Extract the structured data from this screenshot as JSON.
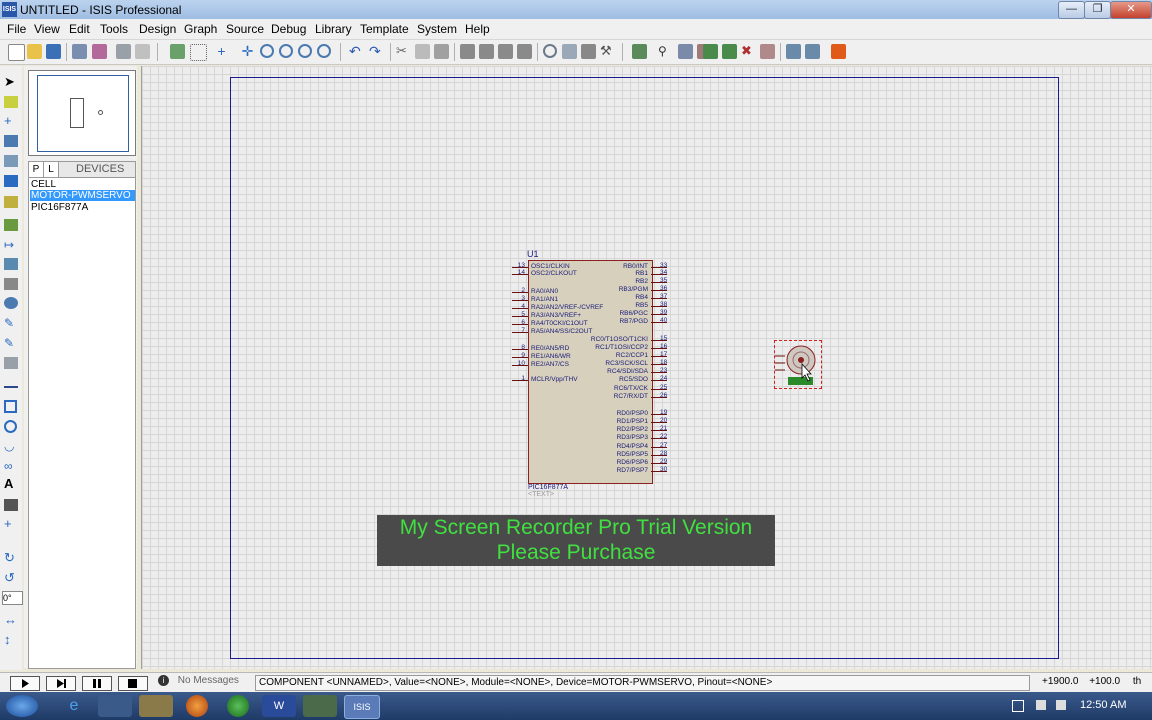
{
  "window": {
    "title": "UNTITLED - ISIS Professional",
    "app_icon": "ISIS"
  },
  "menu": [
    "File",
    "View",
    "Edit",
    "Tools",
    "Design",
    "Graph",
    "Source",
    "Debug",
    "Library",
    "Template",
    "System",
    "Help"
  ],
  "devices": {
    "tab_p": "P",
    "tab_l": "L",
    "header": "DEVICES",
    "items": [
      "CELL",
      "MOTOR-PWMSERVO",
      "PIC16F877A"
    ]
  },
  "angle": "0°",
  "chip": {
    "ref": "U1",
    "value": "PIC16F877A",
    "text": "<TEXT>",
    "left_pins": [
      {
        "num": "13",
        "name": "OSC1/CLKIN"
      },
      {
        "num": "14",
        "name": "OSC2/CLKOUT"
      },
      {
        "num": "2",
        "name": "RA0/AN0"
      },
      {
        "num": "3",
        "name": "RA1/AN1"
      },
      {
        "num": "4",
        "name": "RA2/AN2/VREF-/CVREF"
      },
      {
        "num": "5",
        "name": "RA3/AN3/VREF+"
      },
      {
        "num": "6",
        "name": "RA4/T0CKI/C1OUT"
      },
      {
        "num": "7",
        "name": "RA5/AN4/SS/C2OUT"
      },
      {
        "num": "8",
        "name": "RE0/AN5/RD"
      },
      {
        "num": "9",
        "name": "RE1/AN6/WR"
      },
      {
        "num": "10",
        "name": "RE2/AN7/CS"
      },
      {
        "num": "1",
        "name": "MCLR/Vpp/THV"
      }
    ],
    "right_pins": [
      {
        "num": "33",
        "name": "RB0/INT"
      },
      {
        "num": "34",
        "name": "RB1"
      },
      {
        "num": "35",
        "name": "RB2"
      },
      {
        "num": "36",
        "name": "RB3/PGM"
      },
      {
        "num": "37",
        "name": "RB4"
      },
      {
        "num": "38",
        "name": "RB5"
      },
      {
        "num": "39",
        "name": "RB6/PGC"
      },
      {
        "num": "40",
        "name": "RB7/PGD"
      },
      {
        "num": "15",
        "name": "RC0/T1OSO/T1CKI"
      },
      {
        "num": "16",
        "name": "RC1/T1OSI/CCP2"
      },
      {
        "num": "17",
        "name": "RC2/CCP1"
      },
      {
        "num": "18",
        "name": "RC3/SCK/SCL"
      },
      {
        "num": "23",
        "name": "RC4/SDI/SDA"
      },
      {
        "num": "24",
        "name": "RC5/SDO"
      },
      {
        "num": "25",
        "name": "RC6/TX/CK"
      },
      {
        "num": "26",
        "name": "RC7/RX/DT"
      },
      {
        "num": "19",
        "name": "RD0/PSP0"
      },
      {
        "num": "20",
        "name": "RD1/PSP1"
      },
      {
        "num": "21",
        "name": "RD2/PSP2"
      },
      {
        "num": "22",
        "name": "RD3/PSP3"
      },
      {
        "num": "27",
        "name": "RD4/PSP4"
      },
      {
        "num": "28",
        "name": "RD5/PSP5"
      },
      {
        "num": "29",
        "name": "RD6/PSP6"
      },
      {
        "num": "30",
        "name": "RD7/PSP7"
      }
    ]
  },
  "watermark": {
    "line1": "My Screen Recorder Pro Trial Version",
    "line2": "Please Purchase"
  },
  "status": {
    "messages": "No Messages",
    "text": "COMPONENT <UNNAMED>, Value=<NONE>, Module=<NONE>, Device=MOTOR-PWMSERVO, Pinout=<NONE>",
    "x": "+1900.0",
    "y": "+100.0",
    "unit": "th"
  },
  "taskbar": {
    "time": "12:50 AM",
    "isis_label": "ISIS"
  },
  "colors": {
    "accent": "#3399ff",
    "watermark_text": "#40e040",
    "pin_text": "#1a1a7a"
  }
}
